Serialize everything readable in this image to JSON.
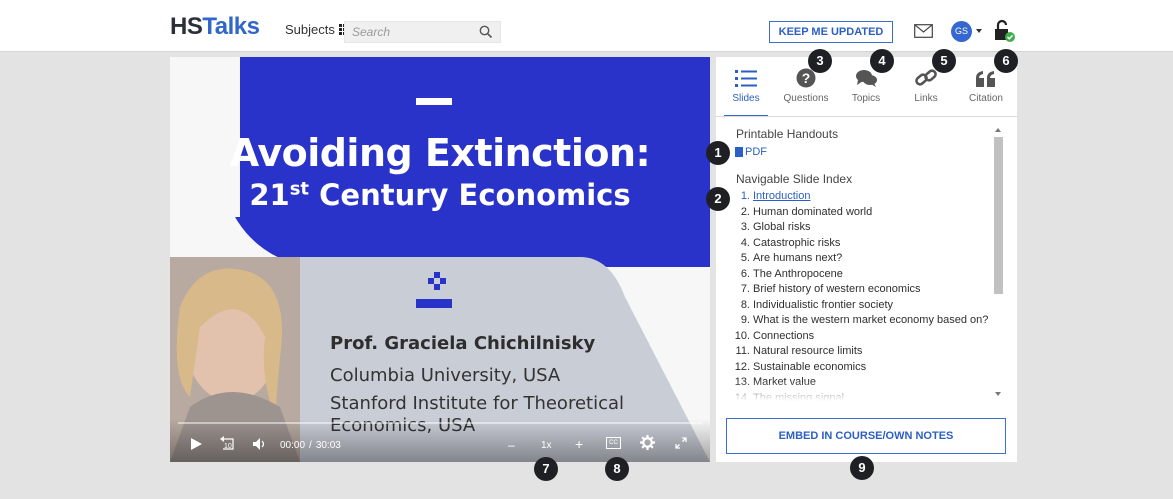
{
  "header": {
    "logo_hs": "HS",
    "logo_talks": "Talks",
    "subjects_label": "Subjects",
    "search_placeholder": "Search",
    "keep_updated_label": "KEEP ME UPDATED",
    "avatar_initials": "GS",
    "icons": {
      "subjects": "grid-icon",
      "search": "search-icon",
      "mail": "envelope-icon",
      "account": "avatar",
      "access": "unlocked-padlock-icon"
    }
  },
  "video": {
    "title_line1": "Avoiding Extinction:",
    "title_line2_main": "21",
    "title_line2_sup": "st",
    "title_line2_rest": " Century Economics",
    "speaker_name": "Prof. Graciela Chichilnisky",
    "affiliation1": "Columbia University, USA",
    "affiliation2": "Stanford Institute for Theoretical Economics, USA",
    "current_time": "00:00",
    "time_separator": "/",
    "duration": "30:03",
    "speed": "1x",
    "speed_minus": "–",
    "speed_plus": "+",
    "captions_label": "CC",
    "replay_seconds": "10",
    "progress": 0.0
  },
  "sidebar": {
    "tabs": [
      {
        "label": "Slides",
        "icon": "list-icon",
        "active": true
      },
      {
        "label": "Questions",
        "icon": "question-circle-icon",
        "active": false
      },
      {
        "label": "Topics",
        "icon": "speech-bubbles-icon",
        "active": false
      },
      {
        "label": "Links",
        "icon": "chain-link-icon",
        "active": false
      },
      {
        "label": "Citation",
        "icon": "quote-icon",
        "active": false
      }
    ],
    "printable_handouts_title": "Printable Handouts",
    "pdf_label": "PDF",
    "slide_index_title": "Navigable Slide Index",
    "slides": [
      {
        "num": "1.",
        "title": "Introduction"
      },
      {
        "num": "2.",
        "title": "Human dominated world"
      },
      {
        "num": "3.",
        "title": "Global risks"
      },
      {
        "num": "4.",
        "title": "Catastrophic risks"
      },
      {
        "num": "5.",
        "title": "Are humans next?"
      },
      {
        "num": "6.",
        "title": "The Anthropocene"
      },
      {
        "num": "7.",
        "title": "Brief history of western economics"
      },
      {
        "num": "8.",
        "title": "Individualistic frontier society"
      },
      {
        "num": "9.",
        "title": "What is the western market economy based on?"
      },
      {
        "num": "10.",
        "title": "Connections"
      },
      {
        "num": "11.",
        "title": "Natural resource limits"
      },
      {
        "num": "12.",
        "title": "Sustainable economics"
      },
      {
        "num": "13.",
        "title": "Market value"
      },
      {
        "num": "14.",
        "title": "The missing signal"
      }
    ],
    "embed_label": "EMBED IN COURSE/OWN NOTES"
  },
  "markers": [
    "1",
    "2",
    "3",
    "4",
    "5",
    "6",
    "7",
    "8",
    "9"
  ],
  "colors": {
    "brand_blue": "#3067c9",
    "slide_blue": "#2932c9",
    "marker_dark": "#1f2024",
    "page_bg": "#e3e3e3"
  }
}
